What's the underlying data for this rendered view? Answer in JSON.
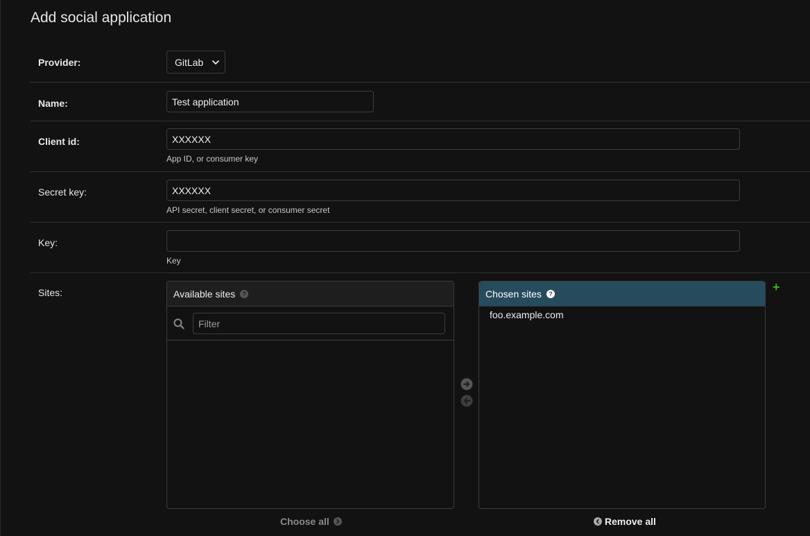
{
  "page": {
    "title": "Add social application"
  },
  "form": {
    "provider": {
      "label": "Provider:",
      "selected": "GitLab"
    },
    "name": {
      "label": "Name:",
      "value": "Test application"
    },
    "client_id": {
      "label": "Client id:",
      "value": "XXXXXX",
      "help": "App ID, or consumer key"
    },
    "secret_key": {
      "label": "Secret key:",
      "value": "XXXXXX",
      "help": "API secret, client secret, or consumer secret"
    },
    "key": {
      "label": "Key:",
      "value": "",
      "help": "Key"
    },
    "sites": {
      "label": "Sites:",
      "available_title": "Available sites",
      "chosen_title": "Chosen sites",
      "filter_placeholder": "Filter",
      "available_items": [],
      "chosen_items": [
        "foo.example.com"
      ],
      "choose_all_label": "Choose all",
      "remove_all_label": "Remove all",
      "add_symbol": "+",
      "help_glyph": "?"
    }
  },
  "colors": {
    "background": "#121212",
    "chosen_header": "#264b5d",
    "add_green": "#44aa22",
    "divider": "#333333"
  },
  "icons": {
    "search": "search-icon",
    "help": "help-icon",
    "arrow_right": "arrow-right-circle-icon",
    "arrow_left": "arrow-left-circle-icon",
    "chevron": "chevron-down-icon",
    "add": "plus-icon"
  }
}
